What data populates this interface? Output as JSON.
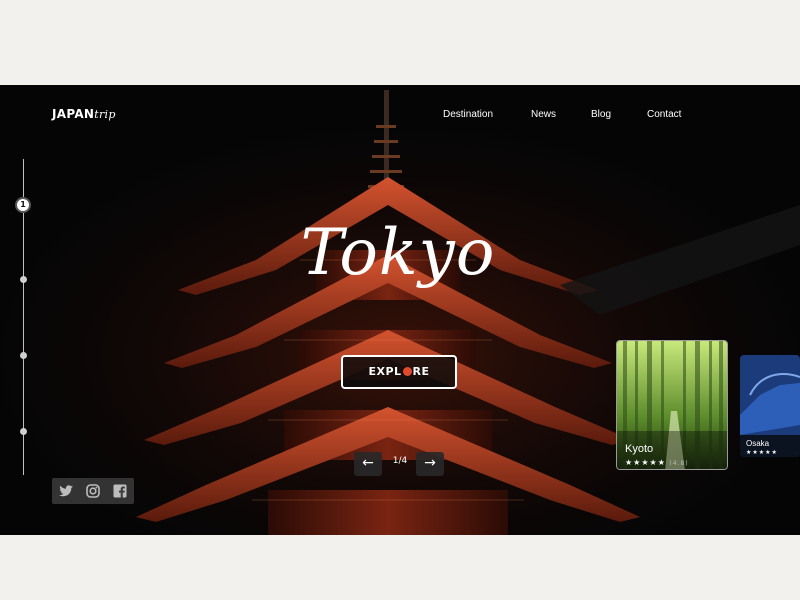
{
  "brand": {
    "strong": "JAPAN",
    "light": "trip"
  },
  "nav": {
    "destination": "Destination",
    "news": "News",
    "blog": "Blog",
    "contact": "Contact"
  },
  "hero": {
    "city": "Tokyo",
    "explore_label_a": "EXPL",
    "explore_label_b": "RE",
    "explore_dot_color": "#e34a2b"
  },
  "progress": {
    "current": "1",
    "steps_total": 4
  },
  "pager": {
    "prev_icon": "arrow-left-icon",
    "next_icon": "arrow-right-icon",
    "prev": "←",
    "next": "→",
    "count": "1/4"
  },
  "social": {
    "icons": [
      "twitter-icon",
      "instagram-icon",
      "facebook-icon"
    ]
  },
  "cards": [
    {
      "name": "Kyoto",
      "stars": "★★★★★",
      "rating": "(4.8)"
    },
    {
      "name": "Osaka",
      "stars": "★★★★★"
    }
  ]
}
